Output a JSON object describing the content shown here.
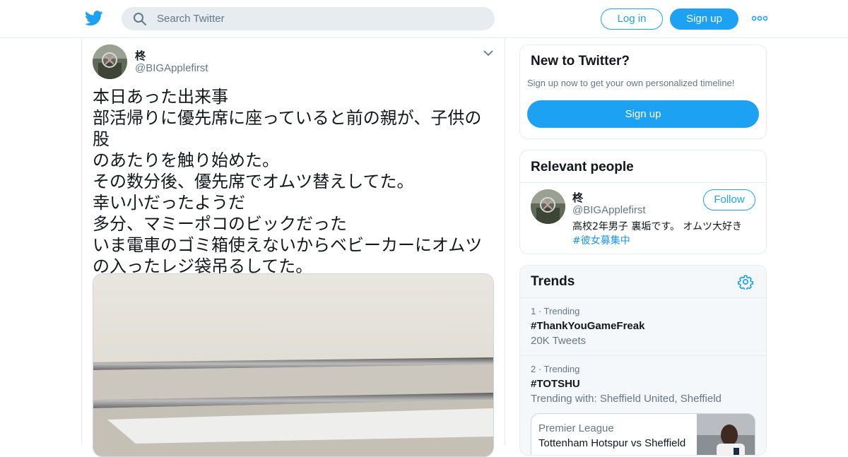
{
  "header": {
    "search_placeholder": "Search Twitter",
    "login_label": "Log in",
    "signup_label": "Sign up",
    "accent_color": "#1da1f2"
  },
  "tweet": {
    "author_name": "柊",
    "author_handle": "@BIGApplefirst",
    "text": "本日あった出来事\n部活帰りに優先席に座っていると前の親が、子供の股\nのあたりを触り始めた。\nその数分後、優先席でオムツ替えしてた。\n幸い小だったようだ\n多分、マミーポコのビックだった\nいま電車のゴミ箱使えないからベビーカーにオムツ\nの入ったレジ袋吊るしてた。"
  },
  "sidebar": {
    "new_to_twitter": {
      "title": "New to Twitter?",
      "subtitle": "Sign up now to get your own personalized timeline!",
      "button_label": "Sign up"
    },
    "relevant_people": {
      "title": "Relevant people",
      "person": {
        "name": "柊",
        "handle": "@BIGApplefirst",
        "follow_label": "Follow",
        "bio": "高校2年男子 裏垢です。 オムツ大好き",
        "bio_hashtag": "#彼女募集中"
      }
    },
    "trends": {
      "title": "Trends",
      "items": [
        {
          "meta": "1 · Trending",
          "name": "#ThankYouGameFreak",
          "sub": "20K Tweets"
        },
        {
          "meta": "2 · Trending",
          "name": "#TOTSHU",
          "sub": "Trending with: Sheffield United, Sheffield"
        }
      ],
      "news": {
        "source": "Premier League",
        "headline": "Tottenham Hotspur vs Sheffield"
      }
    }
  }
}
